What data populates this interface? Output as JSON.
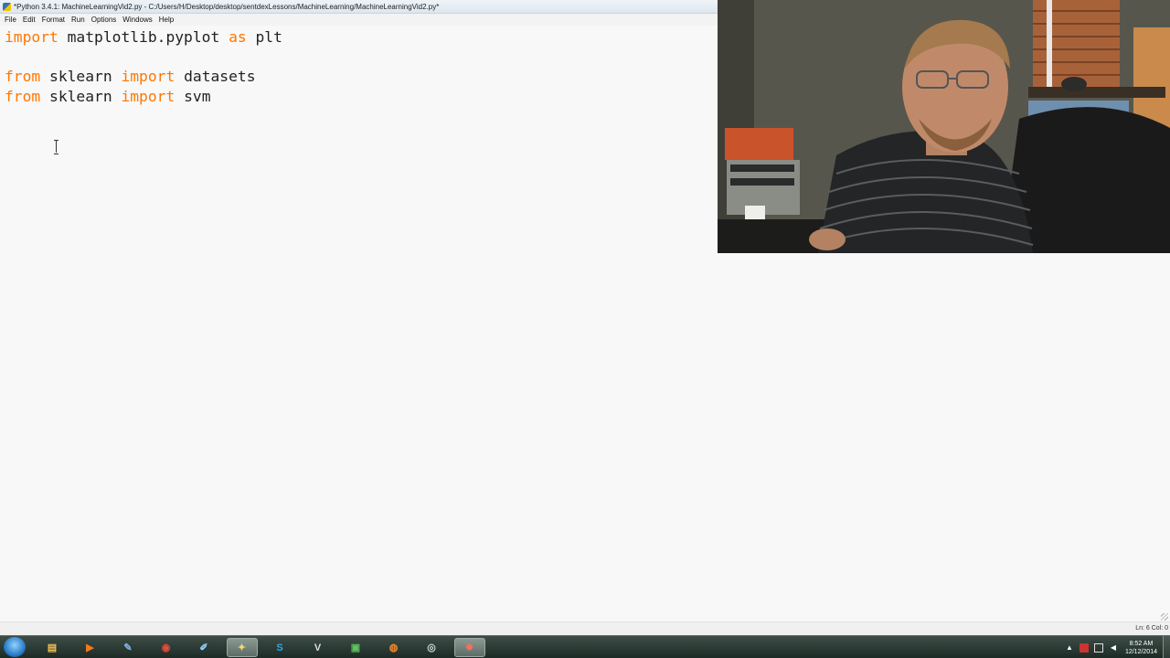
{
  "window": {
    "title": "*Python 3.4.1: MachineLearningVid2.py - C:/Users/H/Desktop/desktop/sentdexLessons/MachineLearning/MachineLearningVid2.py*"
  },
  "menu": {
    "items": [
      "File",
      "Edit",
      "Format",
      "Run",
      "Options",
      "Windows",
      "Help"
    ]
  },
  "editor": {
    "lines": [
      [
        {
          "t": "import",
          "kw": true
        },
        {
          "t": " matplotlib.pyplot ",
          "kw": false
        },
        {
          "t": "as",
          "kw": true
        },
        {
          "t": " plt",
          "kw": false
        }
      ],
      [],
      [
        {
          "t": "from",
          "kw": true
        },
        {
          "t": " sklearn ",
          "kw": false
        },
        {
          "t": "import",
          "kw": true
        },
        {
          "t": " datasets",
          "kw": false
        }
      ],
      [
        {
          "t": "from",
          "kw": true
        },
        {
          "t": " sklearn ",
          "kw": false
        },
        {
          "t": "import",
          "kw": true
        },
        {
          "t": " svm",
          "kw": false
        }
      ]
    ],
    "keyword_color": "#ff7700",
    "text_color": "#222222"
  },
  "statusbar": {
    "position": "Ln: 6 Col: 0"
  },
  "taskbar": {
    "apps": [
      {
        "icon": "file-explorer-icon",
        "active": false
      },
      {
        "icon": "media-player-icon",
        "active": false
      },
      {
        "icon": "paint-icon",
        "active": false
      },
      {
        "icon": "chrome-icon",
        "active": false
      },
      {
        "icon": "notepad-icon",
        "active": false
      },
      {
        "icon": "python-idle-icon",
        "active": true
      },
      {
        "icon": "skype-icon",
        "active": false
      },
      {
        "icon": "bird-icon",
        "active": false
      },
      {
        "icon": "terminal-icon",
        "active": false
      },
      {
        "icon": "firefox-icon",
        "active": false
      },
      {
        "icon": "search-tool-icon",
        "active": false
      },
      {
        "icon": "game-icon",
        "active": true
      }
    ],
    "tray": {
      "time": "8:52 AM",
      "date": "12/12/2014"
    }
  }
}
